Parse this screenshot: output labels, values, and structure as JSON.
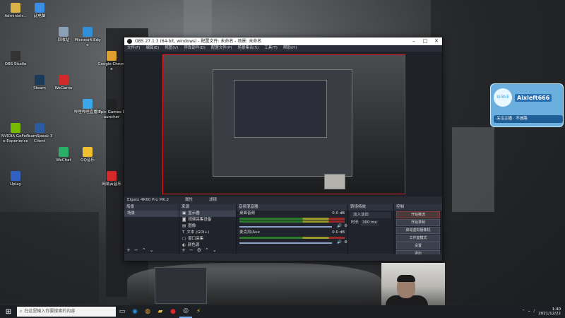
{
  "desktop": {
    "icons": [
      {
        "label": "Administr...",
        "color": "#d9b24a"
      },
      {
        "label": "此电脑",
        "color": "#3a8ee6"
      },
      {
        "label": "回收站",
        "color": "#8aa0b5"
      },
      {
        "label": "Microsoft Edge",
        "color": "#2f8fd8"
      },
      {
        "label": "Google Chrome",
        "color": "#e0a030"
      },
      {
        "label": "OBS Studio",
        "color": "#333"
      },
      {
        "label": "Steam",
        "color": "#1a3a5a"
      },
      {
        "label": "WeGame",
        "color": "#d02a2a"
      },
      {
        "label": "哔哩哔哩直播姬",
        "color": "#3aa7e8"
      },
      {
        "label": "Epic Games Launcher",
        "color": "#222"
      },
      {
        "label": "NVIDIA GeForce Experience",
        "color": "#76b900"
      },
      {
        "label": "TeamSpeak 3 Client",
        "color": "#2a5aa0"
      },
      {
        "label": "WeChat",
        "color": "#2aae67"
      },
      {
        "label": "QQ音乐",
        "color": "#f0c030"
      },
      {
        "label": "网易云音乐",
        "color": "#d62a2a"
      },
      {
        "label": "Uplay",
        "color": "#3060c0"
      }
    ]
  },
  "obs_window": {
    "title": "OBS 27.1.3 (64-bit, windows) - 配置文件: 未命名 - 场景: 未命名",
    "menu": [
      "文件(F)",
      "编辑(E)",
      "视图(V)",
      "停靠部件(D)",
      "配置文件(P)",
      "场景集合(S)",
      "工具(T)",
      "帮助(H)"
    ],
    "dock_headers": {
      "scenes": "场景",
      "sources": "来源",
      "mixer": "音频混音器",
      "transitions": "转场特效",
      "controls": "控制"
    },
    "scenes": [
      "场景"
    ],
    "sources": [
      "显示器",
      "视频采集设备",
      "图像",
      "文本 (GDI+)",
      "窗口采集",
      "颜色源"
    ],
    "mixer_channels": [
      {
        "name": "桌面音频",
        "level": "0.0 dB"
      },
      {
        "name": "麦克风/Aux",
        "level": "0.0 dB"
      }
    ],
    "transition": {
      "name": "淡入淡出",
      "duration_label": "时长",
      "duration": "300 ms"
    },
    "controls": [
      "开始推流",
      "开始录制",
      "启动虚拟摄像机",
      "工作室模式",
      "设置",
      "退出"
    ],
    "properties_button": "属性",
    "filters_button": "滤镜",
    "selected_source_label": "Elgato 4K60 Pro MK.2"
  },
  "bilibili": {
    "brand": "bilibili",
    "username": "Aixleft666",
    "follow_text": "关注主播 · 不迷路"
  },
  "taskbar": {
    "search_placeholder": "在这里输入你要搜索的内容",
    "time": "1:40",
    "date": "2021/12/22"
  },
  "colors": {
    "obs_bg": "#2b2e38",
    "preview_border": "#e02020",
    "taskbar": "#1c1f24",
    "accent": "#3aa7e8"
  }
}
